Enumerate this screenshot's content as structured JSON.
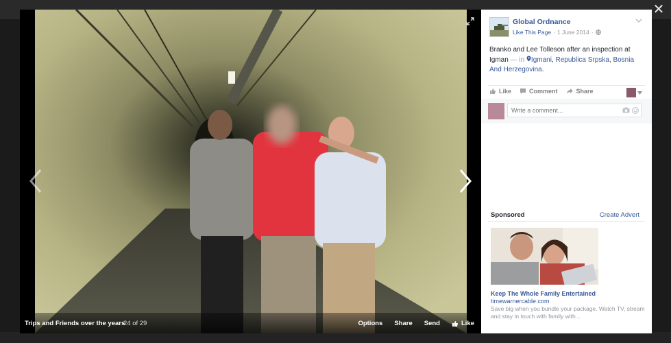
{
  "photo_viewer": {
    "album_title": "Trips and Friends over the years",
    "photo_count": "24 of 29",
    "actions": {
      "options": "Options",
      "share": "Share",
      "send": "Send",
      "like": "Like"
    }
  },
  "post": {
    "page_name": "Global Ordnance",
    "like_page": "Like This Page",
    "separator": "·",
    "date": "1 June 2014",
    "caption_text": "Branko and Lee Tolleson after an inspection at Igman",
    "caption_dash": "— in",
    "location_1": "Igmani",
    "location_2": "Republica Srpska",
    "location_3": "Bosnia And Herzegovina",
    "comma": ","
  },
  "actions": {
    "like": "Like",
    "comment": "Comment",
    "share": "Share"
  },
  "comment_box": {
    "placeholder": "Write a comment..."
  },
  "sponsored": {
    "label": "Sponsored",
    "create_advert": "Create Advert",
    "ad_title": "Keep The Whole Family Entertained",
    "ad_domain": "timewarnercable.com",
    "ad_description": "Save big when you bundle your package. Watch TV, stream and stay in touch with family with..."
  },
  "colors": {
    "link": "#365899",
    "muted": "#90949c",
    "text": "#1d2129"
  },
  "icons": [
    "close-icon",
    "expand-icon",
    "chevron-left-icon",
    "chevron-right-icon",
    "thumbs-up-icon",
    "comment-icon",
    "share-arrow-icon",
    "globe-icon",
    "location-pin-icon",
    "camera-icon",
    "emoji-icon",
    "chevron-down-icon"
  ]
}
